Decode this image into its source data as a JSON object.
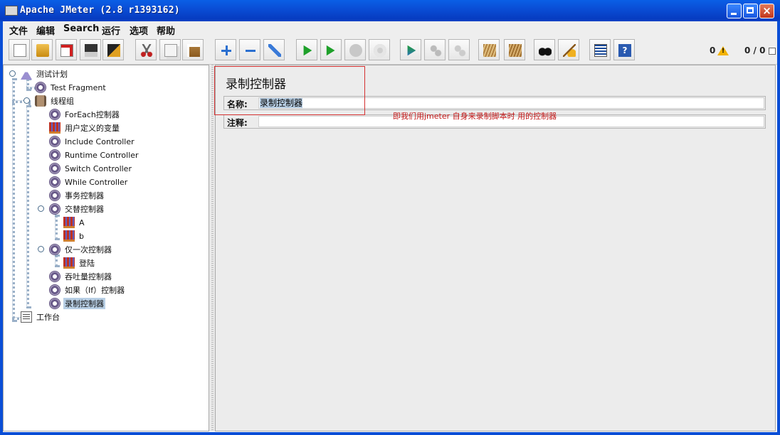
{
  "window": {
    "title": "Apache JMeter (2.8 r1393162)",
    "close_label": "×"
  },
  "menu": [
    {
      "label": "文件"
    },
    {
      "label": "编辑"
    },
    {
      "label": "Search"
    },
    {
      "label": "运行"
    },
    {
      "label": "选项"
    },
    {
      "label": "帮助"
    }
  ],
  "toolbar": {
    "buttons": [
      "new-icon",
      "open-icon",
      "close-plan-icon",
      "save-icon",
      "save-as-icon",
      "cut-icon",
      "copy-icon",
      "paste-icon",
      "expand-icon",
      "collapse-icon",
      "toggle-icon",
      "start-icon",
      "start-no-timers-icon",
      "stop-icon",
      "shutdown-icon",
      "remote-start-icon",
      "remote-stop-icon",
      "remote-shutdown-icon",
      "clear-icon",
      "clear-all-icon",
      "search-icon",
      "reset-search-icon",
      "function-helper-icon",
      "help-icon"
    ],
    "error_count": "0",
    "thread_count": "0 / 0"
  },
  "tree": {
    "nodes": [
      {
        "label": "测试计划",
        "icon": "flask-icon"
      },
      {
        "label": "Test Fragment",
        "icon": "gear-icon"
      },
      {
        "label": "线程组",
        "icon": "spool-icon"
      },
      {
        "label": "ForEach控制器",
        "icon": "gear-icon"
      },
      {
        "label": "用户定义的变量",
        "icon": "variables-icon"
      },
      {
        "label": "Include Controller",
        "icon": "gear-icon"
      },
      {
        "label": "Runtime Controller",
        "icon": "gear-icon"
      },
      {
        "label": "Switch Controller",
        "icon": "gear-icon"
      },
      {
        "label": "While Controller",
        "icon": "gear-icon"
      },
      {
        "label": "事务控制器",
        "icon": "gear-icon"
      },
      {
        "label": "交替控制器",
        "icon": "gear-icon"
      },
      {
        "label": "A",
        "icon": "variables-icon"
      },
      {
        "label": "b",
        "icon": "variables-icon"
      },
      {
        "label": "仅一次控制器",
        "icon": "gear-icon"
      },
      {
        "label": "登陆",
        "icon": "variables-icon"
      },
      {
        "label": "吞吐量控制器",
        "icon": "gear-icon"
      },
      {
        "label": "如果（If）控制器",
        "icon": "gear-icon"
      },
      {
        "label": "录制控制器",
        "icon": "gear-icon",
        "selected": true
      },
      {
        "label": "工作台",
        "icon": "workbench-icon"
      }
    ]
  },
  "editor": {
    "title": "录制控制器",
    "name_label": "名称:",
    "name_value": "录制控制器",
    "comment_label": "注释:",
    "comment_value": ""
  },
  "annotation": {
    "text": "即我们用jmeter 自身来录制脚本时 用的控制器",
    "color": "#c41818"
  }
}
